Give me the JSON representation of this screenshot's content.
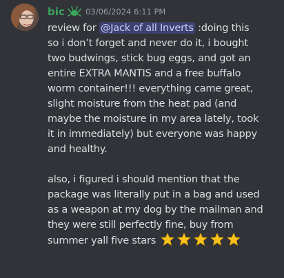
{
  "message": {
    "username": "bic",
    "timestamp": "03/06/2024 6:11 PM",
    "role_icon": "green-bug-icon",
    "mention": "@Jack of all Inverts",
    "line1_pre": "review for ",
    "line1_post": " :doing this",
    "lines": [
      "so i don’t forget and never do it, i bought",
      "two budwings, stick bug eggs, and got an",
      "entire EXTRA MANTIS and a free buffalo",
      "worm container!!! everything came great,",
      "slight moisture from the heat pad (and",
      "maybe the moisture in my area lately, took",
      "it in immediately) but everyone was happy",
      "and healthy."
    ],
    "lines2": [
      "also, i figured i should mention that the",
      "package was literally put in a bag and used",
      "as a weapon at my dog by the mailman and",
      "they were still perfectly fine, buy from"
    ],
    "last_line": "summer yall five stars",
    "stars": [
      "star-icon",
      "star-icon",
      "star-icon",
      "star-icon",
      "star-icon"
    ],
    "colors": {
      "background": "#313338",
      "username": "#3ba55c",
      "mention_bg": "rgba(88,101,242,0.3)",
      "star": "#f8c11c"
    }
  }
}
